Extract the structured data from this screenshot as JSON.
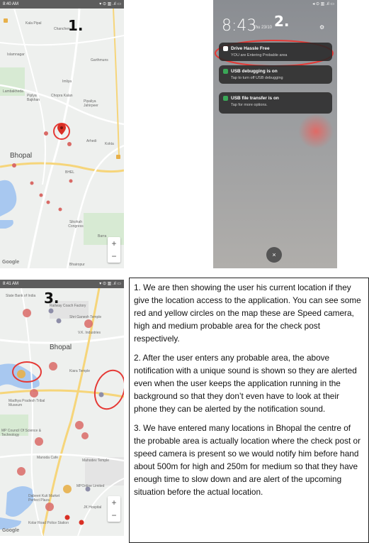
{
  "panel1": {
    "status_time": "8:40 AM",
    "status_right": "▾ ⊙ ▥ .ıl ▭",
    "step": "1.",
    "places": [
      "Kala Pipal",
      "Chanchen",
      "Islamnagar",
      "Garthmuns",
      "Imliya",
      "Lambakheda",
      "Piplya Bajkhan",
      "Chopra Kalan",
      "Pipaliya Jahirpeer",
      "Arhedi",
      "Kokta",
      "Bhopal",
      "BHEL",
      "Sikohah Congress",
      "Barra",
      "Bhairopur"
    ],
    "zoom_in": "+",
    "zoom_out": "−",
    "logo": "Google"
  },
  "panel2": {
    "status_right": "◂ ⊙ ▥ .ıl ▭",
    "time": "8:43",
    "date": "Thu 23/10",
    "step": "2.",
    "notifications": [
      {
        "title": "Drive Hassle Free",
        "text": "YOU are Entering Probable area"
      },
      {
        "title": "USB debugging is on",
        "text": "Tap to turn off USB debugging"
      },
      {
        "title": "USB file transfer is on",
        "text": "Tap for more options."
      }
    ],
    "close_icon": "close-icon",
    "close_label": "×"
  },
  "panel3": {
    "status_time": "8:41 AM",
    "status_right": "▾ ⊙ ▥ .ıl ▭",
    "step": "3.",
    "places": [
      "State Bank of India",
      "Railway Coach Factory",
      "Shri Ganesh Temple",
      "V.K. Industries",
      "Bhopal",
      "Kiara Temple",
      "Madhya Pradesh Tribal Museum",
      "MP Council Of Science & Technology",
      "Manoda Cafe",
      "Mahodev Temple",
      "MPOnline Limited",
      "Kolar Road Police Station",
      "JK Hospital",
      "Dabeeri Kuti Market Perfect Plaza"
    ],
    "zoom_in": "+",
    "zoom_out": "−",
    "logo": "Google"
  },
  "description": {
    "paragraphs": [
      "1. We are then showing the user his current location if they give the location access to the application. You can see some red and yellow circles on the map these are Speed camera, high and medium probable area for the check post respectively.",
      "2. After the user enters any probable area, the above notification with a unique sound is shown so they are alerted even when the user keeps the application running in the background so that they don’t even have to look at their phone they can be alerted by the notification sound.",
      "3. We have entered many locations in Bhopal the centre of the probable area is actually location where the check post or speed camera is present so we would notify him before hand about 500m for high and 250m for medium so that they have enough time to slow down and are alert of the upcoming situation before the actual location."
    ]
  },
  "colors": {
    "highlight_red": "#e53935",
    "marker_red": "#d93025",
    "probable_red": "#d96a66",
    "medium_yellow": "#e7b04a",
    "water_blue": "#a8c8f0",
    "road_yellow": "#f6d57a",
    "usb_green": "#3aa757"
  }
}
